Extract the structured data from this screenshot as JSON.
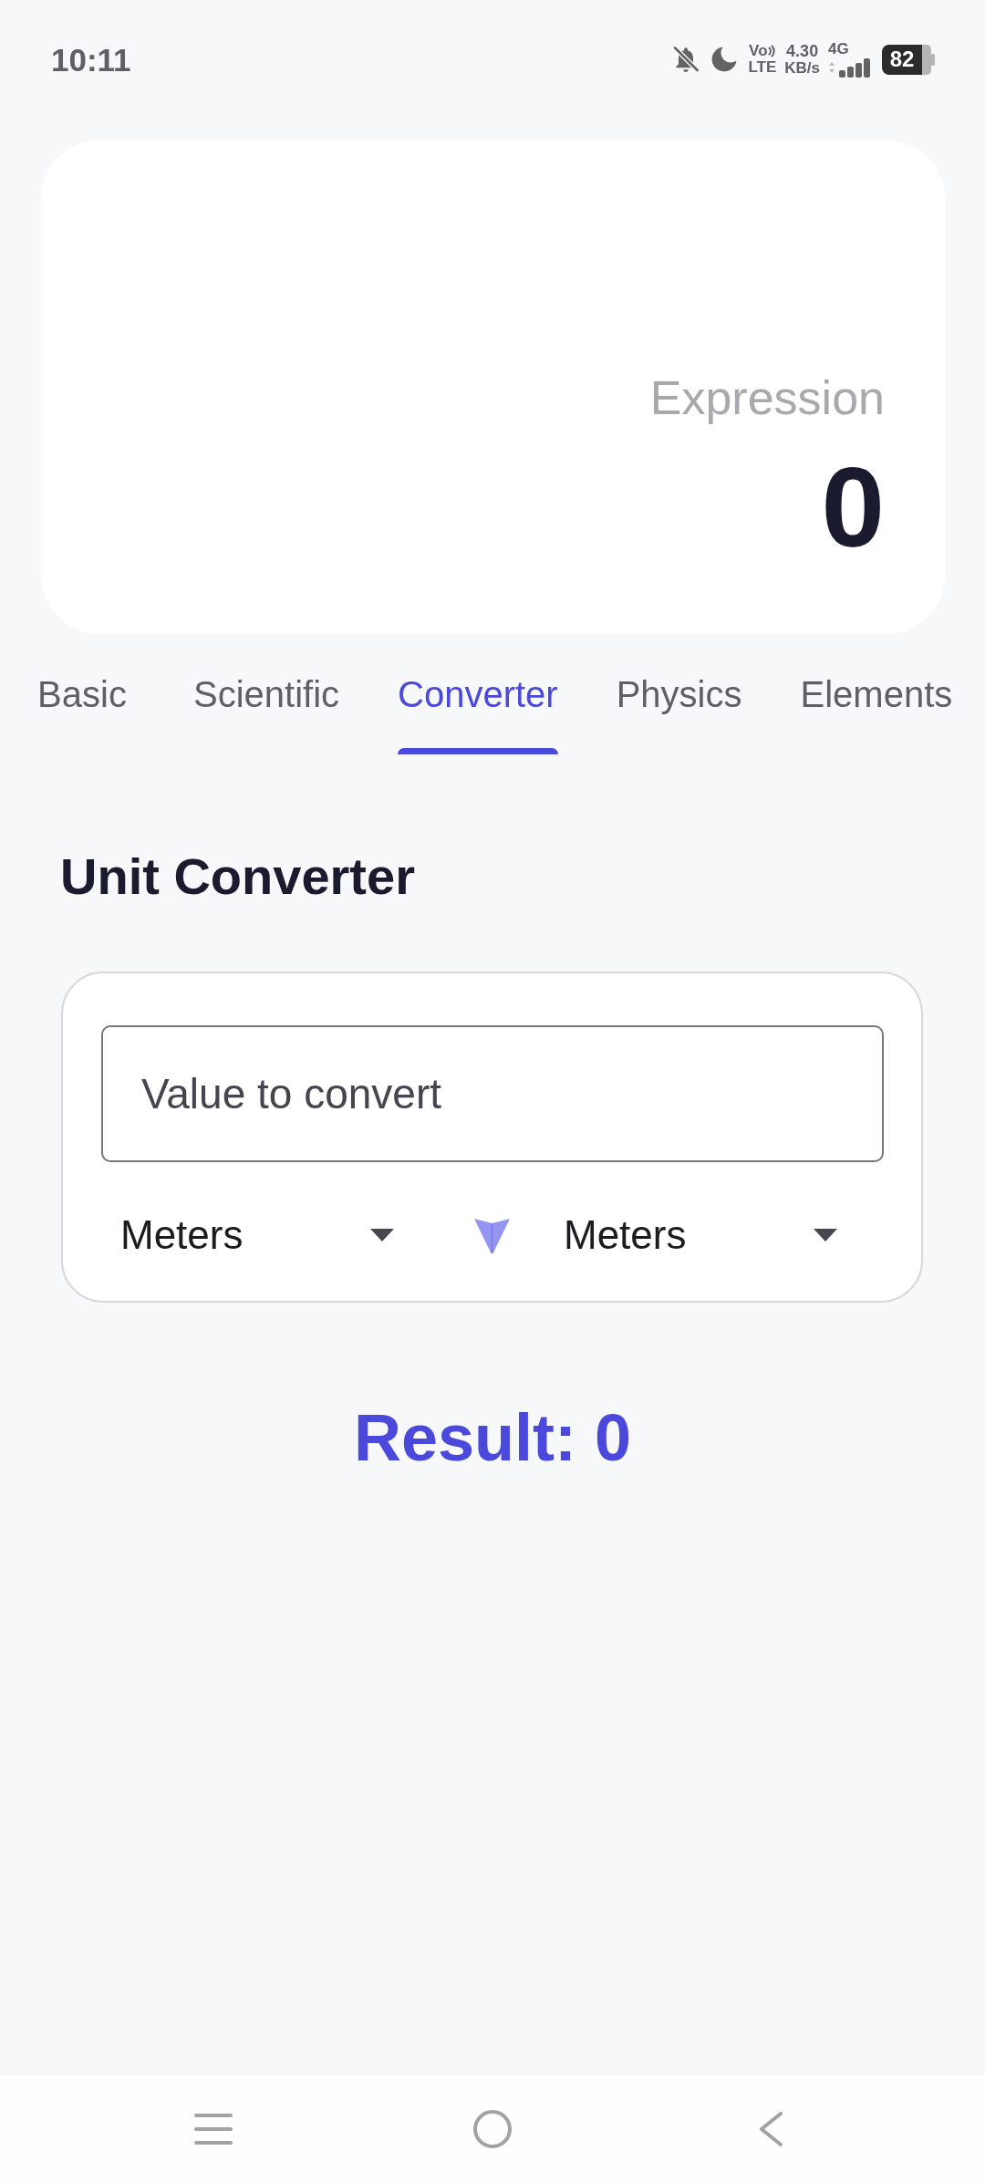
{
  "status_bar": {
    "time": "10:11",
    "volte_top": "Vo",
    "volte_bottom": "LTE",
    "speed": "4.30",
    "speed_unit": "KB/s",
    "network": "4G",
    "battery": "82"
  },
  "display": {
    "expression_hint": "Expression",
    "value": "0"
  },
  "tabs": [
    {
      "label": "Basic",
      "selected": false
    },
    {
      "label": "Scientific",
      "selected": false
    },
    {
      "label": "Converter",
      "selected": true
    },
    {
      "label": "Physics",
      "selected": false
    },
    {
      "label": "Elements",
      "selected": false
    }
  ],
  "converter": {
    "title": "Unit Converter",
    "input": {
      "placeholder": "Value to convert"
    },
    "from_unit": "Meters",
    "to_unit": "Meters",
    "result": "Result: 0"
  }
}
